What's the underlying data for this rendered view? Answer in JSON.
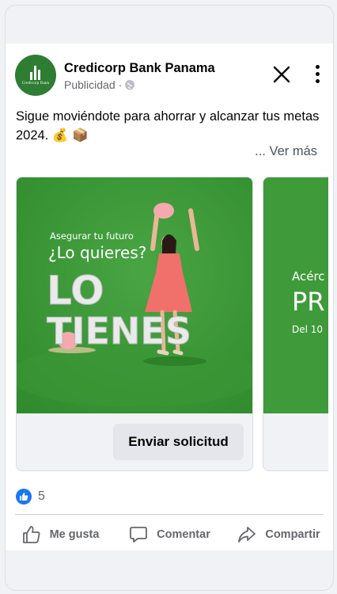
{
  "post": {
    "page_name": "Credicorp Bank Panama",
    "sponsored_label": "Publicidad",
    "sponsored_separator": "·",
    "caption": "Sigue moviéndote para ahorrar y alcanzar tus metas 2024. 💰 📦",
    "see_more": "... Ver más",
    "avatar_logo_text": "Credicorp Bank"
  },
  "carousel": {
    "cards": [
      {
        "line1": "Asegurar tu futuro",
        "line2": "¿Lo quieres?",
        "headline_1": "LO",
        "headline_2": "TIENES",
        "cta": "Enviar solicitud"
      },
      {
        "line1": "Acérc",
        "line2": "PR",
        "line3": "Del 10"
      }
    ]
  },
  "reactions": {
    "count": "5"
  },
  "actions": {
    "like": "Me gusta",
    "comment": "Comentar",
    "share": "Compartir"
  },
  "colors": {
    "brand_green": "#3f9a3a",
    "like_blue": "#1877f2",
    "cta_bg": "#e4e6eb"
  }
}
